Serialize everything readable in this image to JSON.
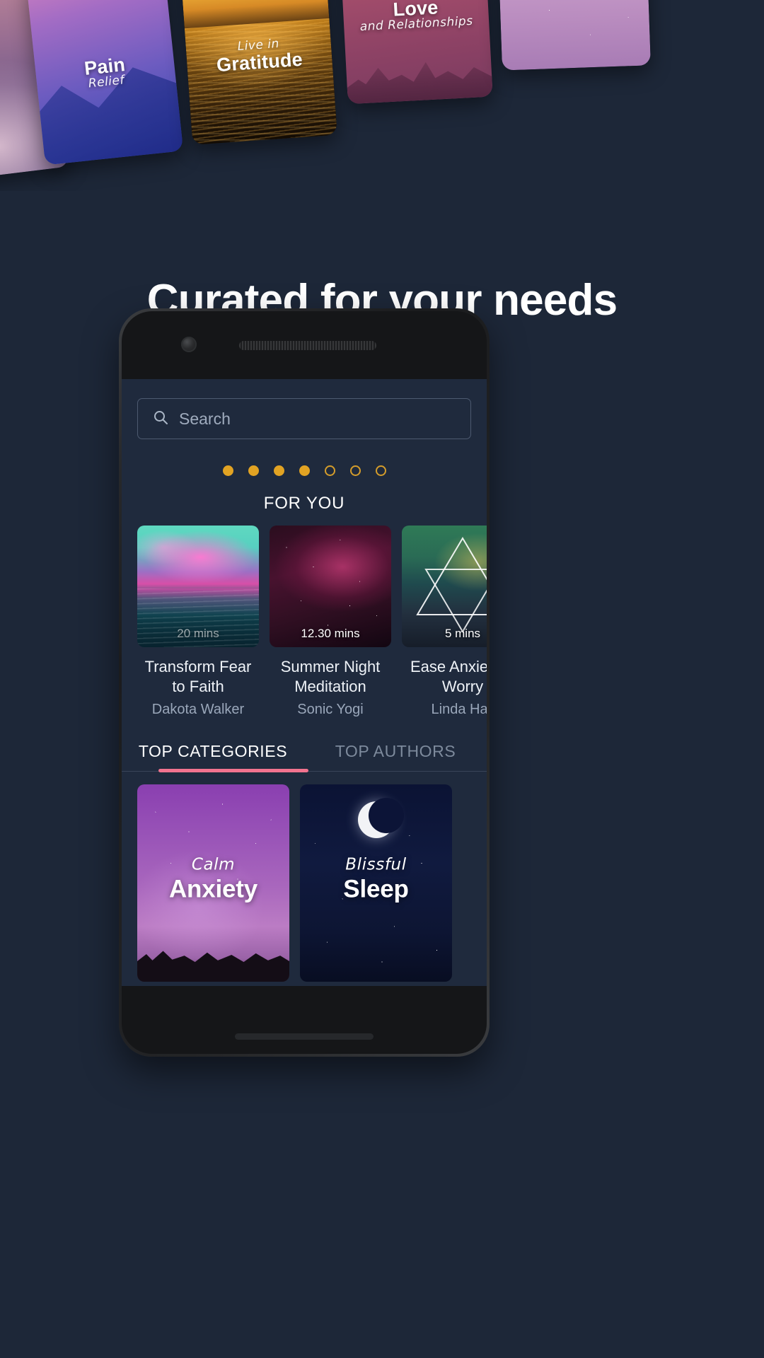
{
  "page": {
    "background_color": "#1d2738",
    "headline": "Curated for your needs"
  },
  "hero_carousel": {
    "cards": [
      {
        "sub": "",
        "main": "",
        "art": "clouds-pink"
      },
      {
        "sub": "Relief",
        "main": "Pain",
        "art": "purple-mountain"
      },
      {
        "sub": "Live in",
        "main": "Gratitude",
        "art": "golden-water"
      },
      {
        "sub": "and Relationships",
        "main": "Love",
        "art": "rose-skyline"
      },
      {
        "sub": "",
        "main": "",
        "art": "lavender-starfield"
      }
    ]
  },
  "phone": {
    "search": {
      "placeholder": "Search",
      "icon": "search-icon"
    },
    "pager": {
      "total": 7,
      "filled": 4,
      "filled_color": "#e2a323",
      "hollow_color": "#d59d2b"
    },
    "for_you": {
      "title": "FOR YOU",
      "cards": [
        {
          "duration": "20 mins",
          "title": "Transform Fear to Faith",
          "author": "Dakota Walker",
          "art": "ocean-sunset"
        },
        {
          "duration": "12.30 mins",
          "title": "Summer Night Meditation",
          "author": "Sonic Yogi",
          "art": "galaxy"
        },
        {
          "duration": "5 mins",
          "title": "Ease Anxiety & Worry",
          "author": "Linda Hall",
          "art": "triangle-mountain"
        }
      ]
    },
    "tabs": {
      "active_index": 0,
      "underline_color": "#f2738f",
      "items": [
        {
          "label": "TOP CATEGORIES"
        },
        {
          "label": "TOP AUTHORS"
        }
      ]
    },
    "categories": {
      "tiles": [
        {
          "sub": "Calm",
          "main": "Anxiety",
          "art": "purple-starfield"
        },
        {
          "sub": "Blissful",
          "main": "Sleep",
          "art": "night-moon"
        }
      ],
      "partial_tiles": [
        {
          "color": "#f0a93a"
        },
        {
          "color": "#e0559a"
        }
      ]
    }
  }
}
